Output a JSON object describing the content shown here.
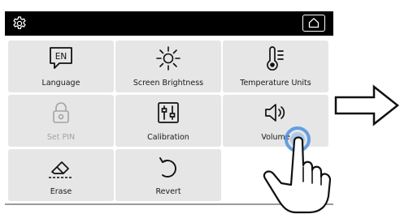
{
  "topbar": {
    "settings_icon": "gear-icon",
    "home_icon": "home-icon"
  },
  "tiles": [
    {
      "label": "Language",
      "icon": "language-en-icon",
      "icon_text": "EN",
      "enabled": true
    },
    {
      "label": "Screen Brightness",
      "icon": "sun-icon",
      "enabled": true
    },
    {
      "label": "Temperature Units",
      "icon": "thermometer-icon",
      "enabled": true
    },
    {
      "label": "Set PIN",
      "icon": "padlock-icon",
      "enabled": false
    },
    {
      "label": "Calibration",
      "icon": "sliders-icon",
      "enabled": true
    },
    {
      "label": "Volume",
      "icon": "speaker-icon",
      "enabled": true,
      "pressed": true
    },
    {
      "label": "Erase",
      "icon": "eraser-icon",
      "enabled": true
    },
    {
      "label": "Revert",
      "icon": "undo-icon",
      "enabled": true
    }
  ],
  "overlay": {
    "arrow_icon": "arrow-right-icon",
    "touch_icon": "pointing-hand-icon"
  },
  "colors": {
    "topbar": "#000000",
    "tile_bg": "#e6e6e6",
    "disabled_text": "#a3a3a3",
    "touch_indicator": "#4a90e2"
  }
}
